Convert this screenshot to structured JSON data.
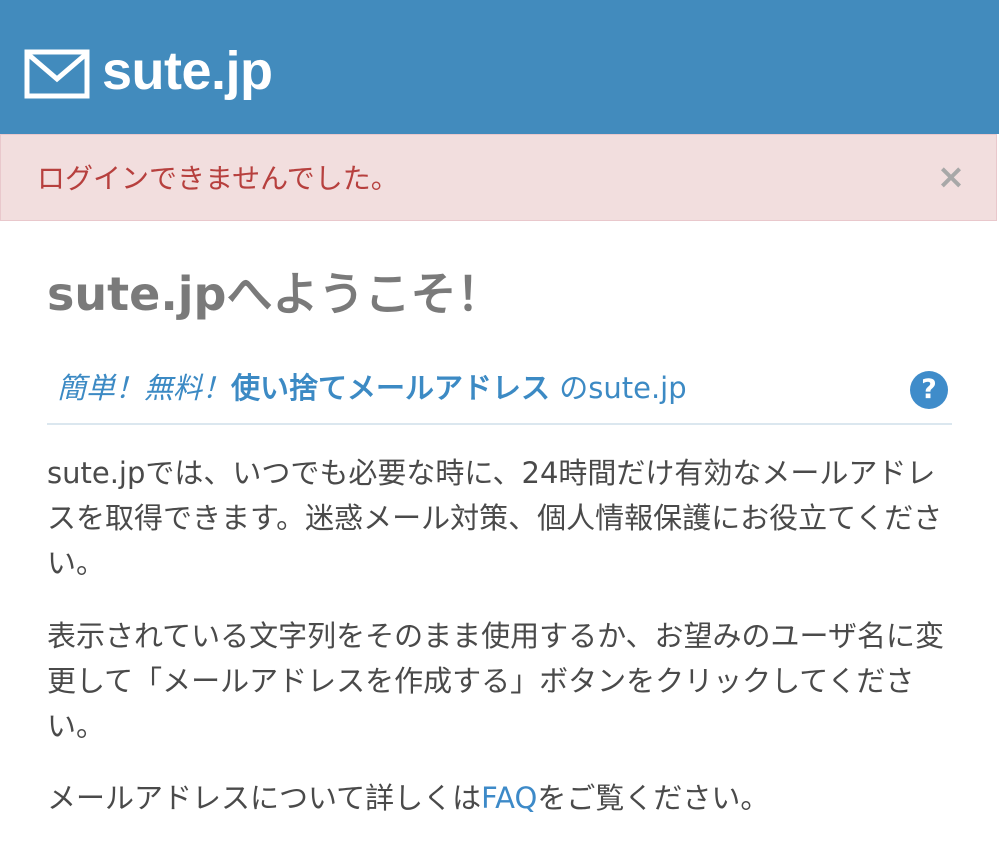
{
  "header": {
    "logo_text": "sute.jp",
    "logo_icon": "envelope-icon",
    "background_color": "#428bbd"
  },
  "alert": {
    "message": "ログインできませんでした。",
    "close_symbol": "×",
    "background_color": "#f2dede",
    "text_color": "#b7403e"
  },
  "main": {
    "title": "sute.jpへようこそ！",
    "tagline": {
      "part1": "簡単！無料！",
      "part2": "使い捨てメールアドレス",
      "part3": "のsute.jp"
    },
    "help_symbol": "?",
    "paragraph1": "sute.jpでは、いつでも必要な時に、24時間だけ有効なメールアドレスを取得できます。迷惑メール対策、個人情報保護にお役立てください。",
    "paragraph2": "表示されている文字列をそのまま使用するか、お望みのユーザ名に変更して「メールアドレスを作成する」ボタンをクリックしてください。",
    "paragraph3": {
      "before": "メールアドレスについて詳しくは",
      "link": "FAQ",
      "after": "をご覧ください。"
    }
  }
}
